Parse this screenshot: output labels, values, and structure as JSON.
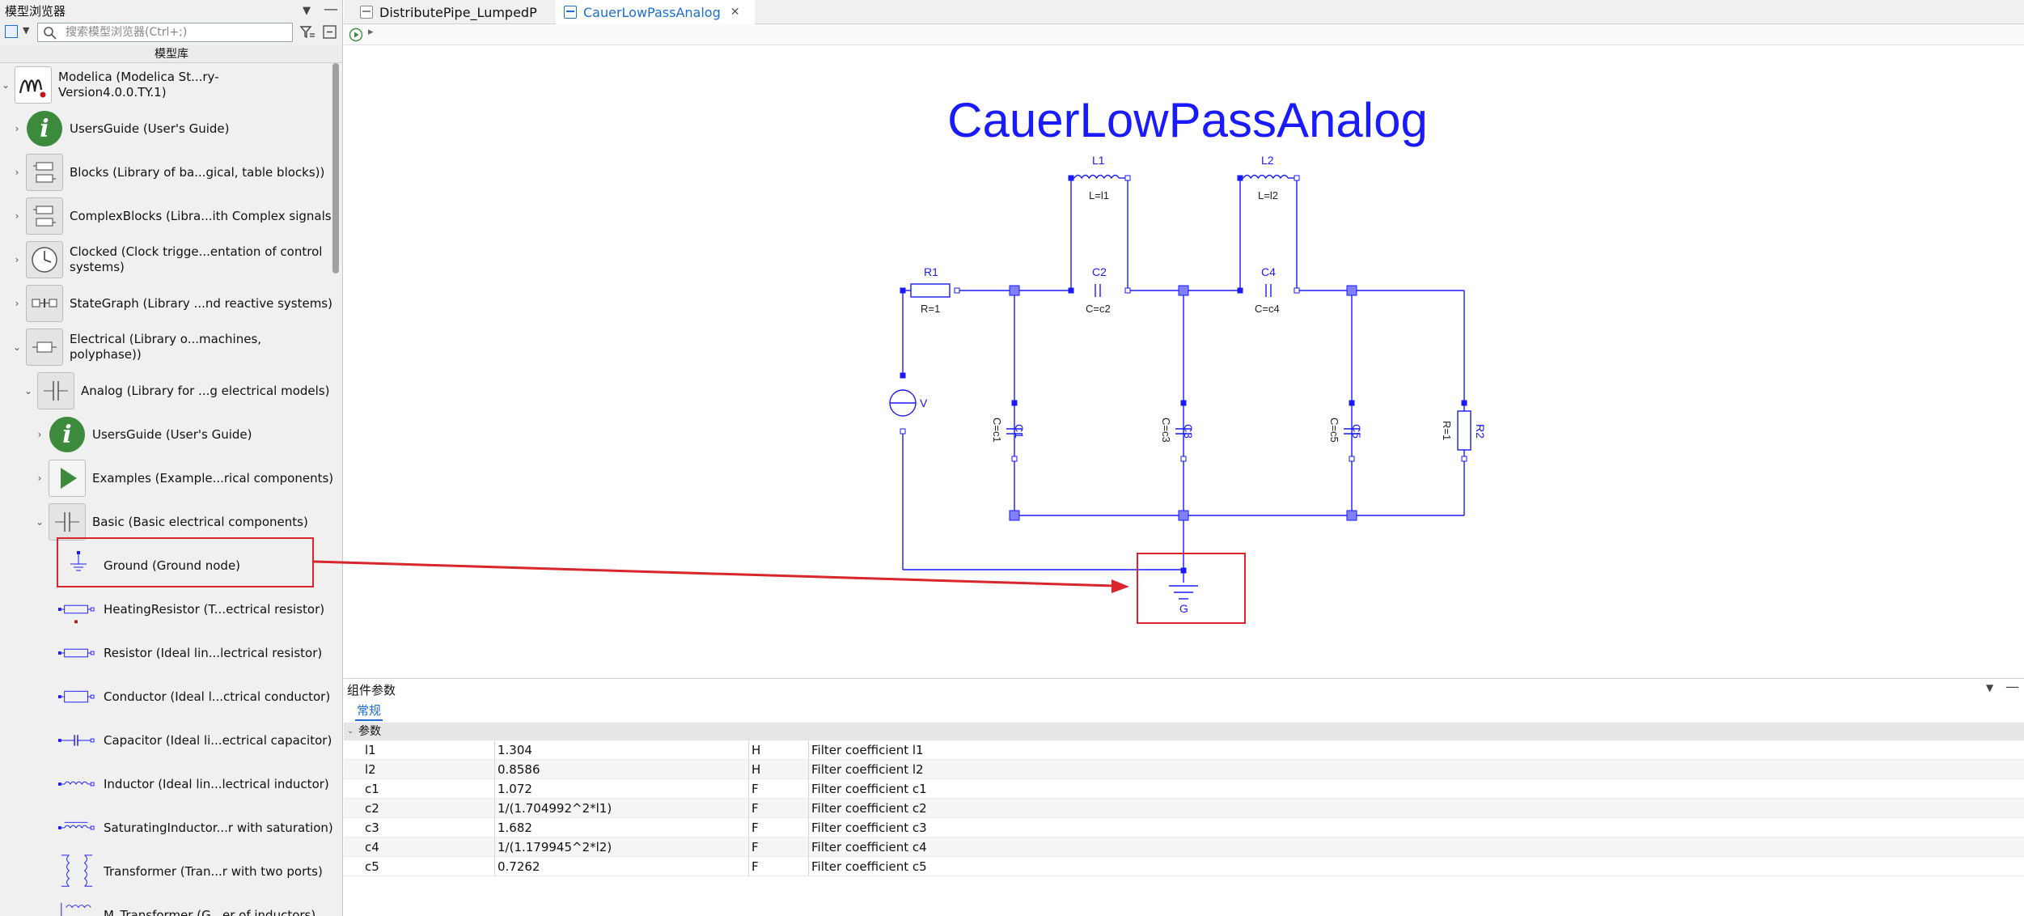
{
  "left_panel": {
    "title": "模型浏览器",
    "search_placeholder": "搜索模型浏览器(Ctrl+;)",
    "header": "模型库",
    "tree": [
      {
        "label": "Modelica (Modelica St...ry-Version4.0.0.TY.1)",
        "icon": "modelica-logo-icon"
      },
      {
        "label": "UsersGuide (User's Guide)",
        "icon": "info-icon"
      },
      {
        "label": "Blocks (Library of ba...gical, table blocks))",
        "icon": "blocks-library-icon"
      },
      {
        "label": "ComplexBlocks (Libra...ith Complex signals)",
        "icon": "complex-blocks-icon"
      },
      {
        "label": "Clocked (Clock trigge...entation of control systems)",
        "icon": "clock-icon"
      },
      {
        "label": "StateGraph (Library ...nd reactive systems)",
        "icon": "stategraph-icon"
      },
      {
        "label": "Electrical (Library o...machines, polyphase))",
        "icon": "electrical-library-icon"
      },
      {
        "label": "Analog (Library for ...g electrical models)",
        "icon": "analog-library-icon"
      },
      {
        "label": "UsersGuide (User's Guide)",
        "icon": "info-icon"
      },
      {
        "label": "Examples (Example...rical components)",
        "icon": "play-icon"
      },
      {
        "label": "Basic (Basic electrical components)",
        "icon": "basic-library-icon"
      },
      {
        "label": "Ground (Ground node)",
        "icon": "ground-icon"
      },
      {
        "label": "HeatingResistor (T...ectrical resistor)",
        "icon": "heating-resistor-icon"
      },
      {
        "label": "Resistor (Ideal lin...lectrical resistor)",
        "icon": "resistor-icon"
      },
      {
        "label": "Conductor (Ideal l...ctrical conductor)",
        "icon": "conductor-icon"
      },
      {
        "label": "Capacitor (Ideal li...ectrical capacitor)",
        "icon": "capacitor-icon"
      },
      {
        "label": "Inductor (Ideal lin...lectrical inductor)",
        "icon": "inductor-icon"
      },
      {
        "label": "SaturatingInductor...r with saturation)",
        "icon": "saturating-inductor-icon"
      },
      {
        "label": "Transformer (Tran...r with two ports)",
        "icon": "transformer-icon"
      },
      {
        "label": "M_Transformer (G...er of inductors)",
        "icon": "m-transformer-icon"
      }
    ]
  },
  "tabs": [
    {
      "label": "DistributePipe_LumpedP",
      "active": false
    },
    {
      "label": "CauerLowPassAnalog",
      "active": true
    }
  ],
  "diagram": {
    "title": "CauerLowPassAnalog",
    "labels": {
      "L1": "L1",
      "L1_param": "L=l1",
      "L2": "L2",
      "L2_param": "L=l2",
      "R1": "R1",
      "R1_param": "R=1",
      "C2": "C2",
      "C2_param": "C=c2",
      "C4": "C4",
      "C4_param": "C=c4",
      "V": "V",
      "C1": "C1",
      "C1_param": "C=c1",
      "C3": "C3",
      "C3_param": "C=c3",
      "C5": "C5",
      "C5_param": "C=c5",
      "R2": "R2",
      "R2_param": "R=1",
      "G": "G"
    }
  },
  "params": {
    "title": "组件参数",
    "tab": "常规",
    "group": "参数",
    "rows": [
      {
        "name": "l1",
        "value": "1.304",
        "unit": "H",
        "desc": "Filter coefficient l1"
      },
      {
        "name": "l2",
        "value": "0.8586",
        "unit": "H",
        "desc": "Filter coefficient l2"
      },
      {
        "name": "c1",
        "value": "1.072",
        "unit": "F",
        "desc": "Filter coefficient c1"
      },
      {
        "name": "c2",
        "value": "1/(1.704992^2*l1)",
        "unit": "F",
        "desc": "Filter coefficient c2"
      },
      {
        "name": "c3",
        "value": "1.682",
        "unit": "F",
        "desc": "Filter coefficient c3"
      },
      {
        "name": "c4",
        "value": "1/(1.179945^2*l2)",
        "unit": "F",
        "desc": "Filter coefficient c4"
      },
      {
        "name": "c5",
        "value": "0.7262",
        "unit": "F",
        "desc": "Filter coefficient c5"
      }
    ]
  },
  "colors": {
    "accent": "#1a6fd1",
    "diagram": "#1a1aff",
    "highlight": "#d9262c"
  }
}
